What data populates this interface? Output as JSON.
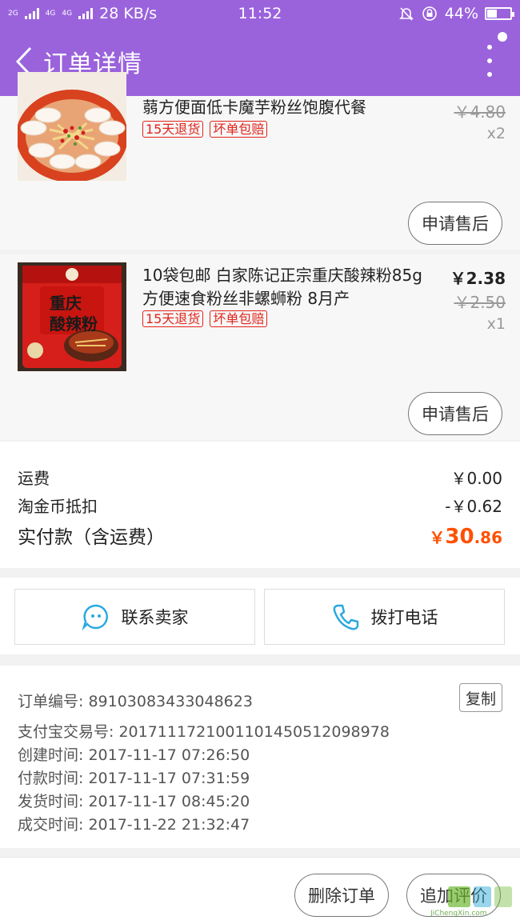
{
  "status_bar": {
    "signal_labels": [
      "2G",
      "4G",
      "4G"
    ],
    "network_speed": "28 KB/s",
    "time": "11:52",
    "battery_percent": "44%",
    "battery_level": 0.44
  },
  "header": {
    "title": "订单详情"
  },
  "products": [
    {
      "name": "蒻方便面低卡魔芋粉丝饱腹代餐",
      "tags": [
        "15天退货",
        "坏单包赔"
      ],
      "original_price": "￥4.80",
      "quantity": "x2",
      "after_sale_label": "申请售后"
    },
    {
      "name": "10袋包邮 白家陈记正宗重庆酸辣粉85g方便速食粉丝非螺蛳粉 8月产",
      "tags": [
        "15天退货",
        "坏单包赔"
      ],
      "price": "￥2.38",
      "original_price": "￥2.50",
      "quantity": "x1",
      "after_sale_label": "申请售后",
      "package_text": [
        "重庆",
        "酸辣粉"
      ]
    }
  ],
  "fees": {
    "shipping_label": "运费",
    "shipping_value": "￥0.00",
    "coin_label": "淘金币抵扣",
    "coin_value": "-￥0.62",
    "total_label": "实付款（含运费）",
    "total_currency": "￥",
    "total_integer": "30",
    "total_decimal": ".86"
  },
  "contact": {
    "seller_label": "联系卖家",
    "phone_label": "拨打电话"
  },
  "order_info": {
    "order_no": "订单编号: 89103083433048623",
    "alipay_no": "支付宝交易号: 2017111721001101450512098978",
    "created": "创建时间: 2017-11-17 07:26:50",
    "paid": "付款时间: 2017-11-17 07:31:59",
    "shipped": "发货时间: 2017-11-17 08:45:20",
    "completed": "成交时间: 2017-11-22 21:32:47",
    "copy_label": "复制"
  },
  "bottom_bar": {
    "delete_label": "删除订单",
    "review_label": "追加评价"
  },
  "watermark": {
    "text": "JiChengXin.com"
  },
  "colors": {
    "header": "#9a63dc",
    "tag_red": "#e2231a",
    "total_orange": "#ff5000",
    "contact_icon": "#29a9e0"
  }
}
